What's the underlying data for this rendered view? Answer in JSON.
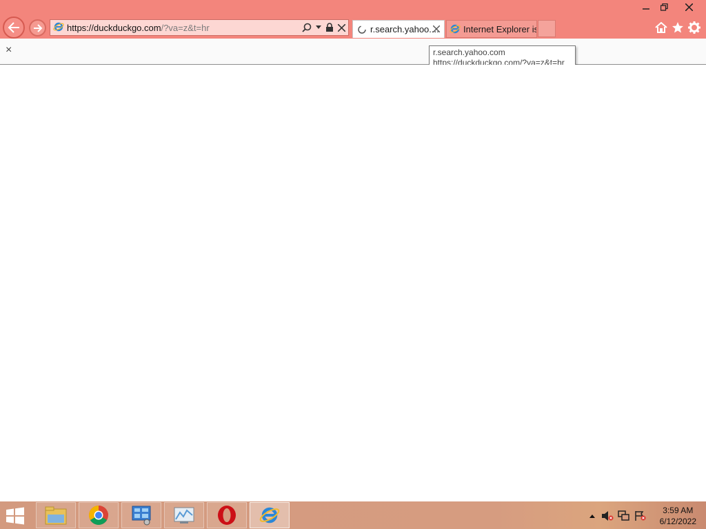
{
  "browser": {
    "address_host": "https://duckduckgo.com",
    "address_rest": "/?va=z&t=hr",
    "tabs": [
      {
        "title": "r.search.yahoo....",
        "active": true
      },
      {
        "title": "Internet Explorer is...",
        "active": false
      }
    ],
    "tooltip": {
      "line1": "r.search.yahoo.com",
      "line2": "https://duckduckgo.com/?va=z&t=hr"
    },
    "infobar_close": "×"
  },
  "taskbar": {
    "time": "3:59 AM",
    "date": "6/12/2022",
    "apps": [
      "file-explorer",
      "chrome",
      "control-panel",
      "task-manager",
      "opera",
      "internet-explorer"
    ]
  },
  "colors": {
    "titlebar": "#f3857c",
    "taskbar": "#d69c80",
    "address_bg": "#fdd7d3"
  }
}
